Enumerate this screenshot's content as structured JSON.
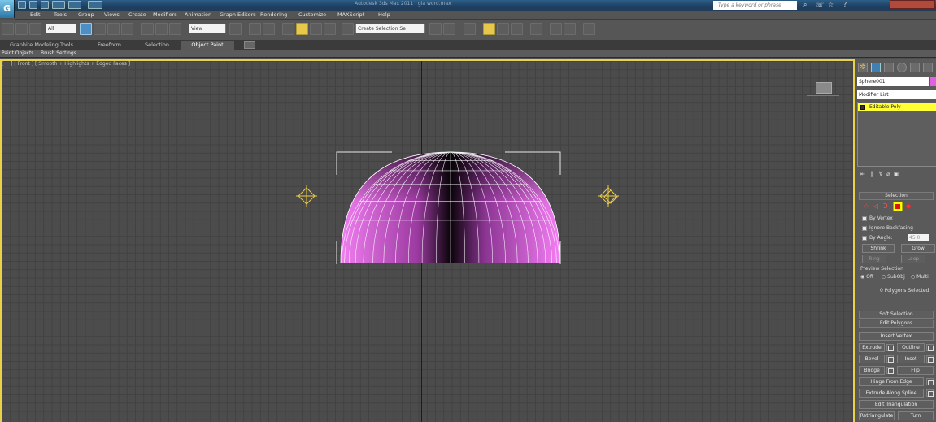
{
  "app": {
    "title": "Autodesk 3ds Max 2011",
    "file": "gia word.max",
    "logo": "3ds-max-logo",
    "help_placeholder": "Type a keyword or phrase"
  },
  "menu": [
    "Edit",
    "Tools",
    "Group",
    "Views",
    "Create",
    "Modifiers",
    "Animation",
    "Graph Editors",
    "Rendering",
    "Customize",
    "MAXScript",
    "Help"
  ],
  "toolbar": {
    "filter": "All",
    "refcoord": "View",
    "selset": "Create Selection Se"
  },
  "ribbon": {
    "tabs": [
      "Graphite Modeling Tools",
      "Freeform",
      "Selection",
      "Object Paint"
    ],
    "active": "Object Paint",
    "subtabs": [
      "Paint Objects",
      "Brush Settings"
    ]
  },
  "viewport": {
    "label": "[ + ] [ Front ] [ Smooth + Highlights + Edged Faces ]",
    "object_color": "#e87de8",
    "grid_color": "#424242",
    "bg_color": "#4c4c4c",
    "border_color": "#e8d24a"
  },
  "command_panel": {
    "object_name": "Sphere001",
    "modifier_list": "Modifier List",
    "stack_item": "Editable Poly",
    "stack_color": "#ffff33",
    "selection": {
      "title": "Selection",
      "by_vertex": "By Vertex",
      "ignore_backfacing": "Ignore Backfacing",
      "by_angle": "By Angle:",
      "angle_value": "45,0",
      "shrink": "Shrink",
      "grow": "Grow",
      "ring": "Ring",
      "loop": "Loop",
      "preview": "Preview Selection",
      "off": "Off",
      "subobj": "SubObj",
      "multi": "Multi",
      "status": "0 Polygons Selected"
    },
    "soft_selection": "Soft Selection",
    "edit_polygons": {
      "title": "Edit Polygons",
      "insert_vertex": "Insert Vertex",
      "extrude": "Extrude",
      "outline": "Outline",
      "bevel": "Bevel",
      "inset": "Inset",
      "bridge": "Bridge",
      "flip": "Flip",
      "hinge": "Hinge From Edge",
      "extrude_spline": "Extrude Along Spline",
      "edit_tri": "Edit Triangulation",
      "retri": "Retriangulate",
      "turn": "Turn"
    }
  }
}
